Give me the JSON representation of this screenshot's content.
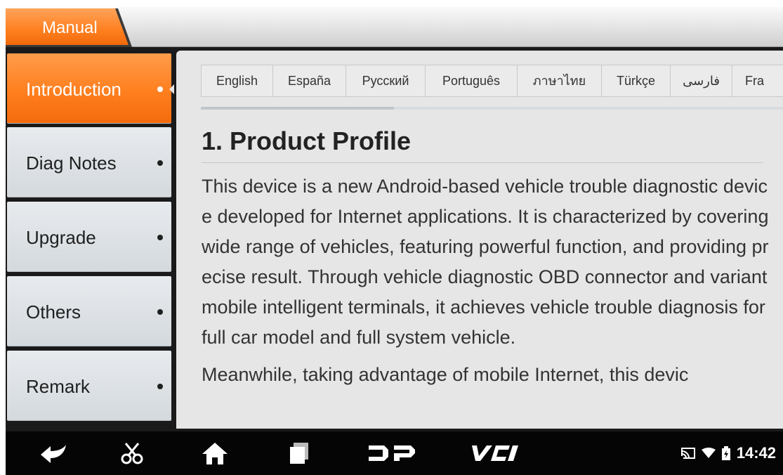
{
  "app": {
    "title": "Manual"
  },
  "sidebar": {
    "items": [
      {
        "label": "Introduction",
        "active": true
      },
      {
        "label": "Diag Notes",
        "active": false
      },
      {
        "label": "Upgrade",
        "active": false
      },
      {
        "label": "Others",
        "active": false
      },
      {
        "label": "Remark",
        "active": false
      }
    ]
  },
  "languages": [
    "English",
    "España",
    "Русский",
    "Português",
    "ภาษาไทย",
    "Türkçe",
    "فارسی",
    "Fra"
  ],
  "document": {
    "title": "1. Product Profile",
    "paragraphs": [
      "This device is a new Android-based vehicle trouble diagnostic device developed for Internet applications. It is characterized by covering wide range of vehicles, featuring powerful function, and providing precise result. Through vehicle diagnostic OBD connector and variant mobile intelligent terminals, it achieves vehicle trouble diagnosis for full car model and full system vehicle.",
      "Meanwhile, taking advantage of mobile Internet, this devic"
    ]
  },
  "navbar": {
    "icons": [
      "back-icon",
      "screenshot-scissors-icon",
      "home-icon",
      "recent-apps-icon",
      "dp-logo-icon",
      "vci-logo-icon"
    ],
    "status": {
      "time": "14:42",
      "icons": [
        "cast-icon",
        "wifi-icon",
        "battery-icon"
      ]
    }
  },
  "colors": {
    "accent": "#ff7f1f",
    "navbar": "#050505",
    "content_bg": "#e6e6e6"
  }
}
